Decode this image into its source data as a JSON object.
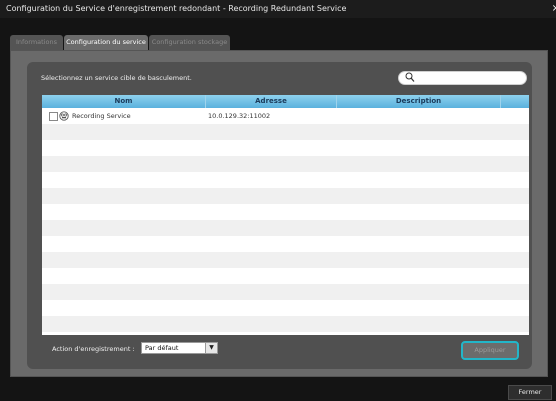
{
  "window": {
    "title": "Configuration du Service d'enregistrement redondant - Recording Redundant Service",
    "close_glyph": "×"
  },
  "tabs": [
    {
      "label": "Informations",
      "active": false
    },
    {
      "label": "Configuration du service",
      "active": true
    },
    {
      "label": "Configuration stockage",
      "active": false
    }
  ],
  "panel": {
    "instruction": "Sélectionnez un service cible de basculement.",
    "search": {
      "placeholder": "",
      "icon": "search-icon"
    },
    "table": {
      "columns": [
        "Nom",
        "Adresse",
        "Description"
      ],
      "rows": [
        {
          "name": "Recording Service",
          "address": "10.0.129.32:11002",
          "description": "",
          "checked": false
        }
      ]
    },
    "action": {
      "label": "Action d'enregistrement :",
      "selected": "Par défaut"
    },
    "apply_label": "Appliquer"
  },
  "footer": {
    "close_label": "Fermer"
  },
  "colors": {
    "accent": "#22b6c9",
    "header": "#5ab1dd",
    "panel": "#6a6a6a"
  }
}
